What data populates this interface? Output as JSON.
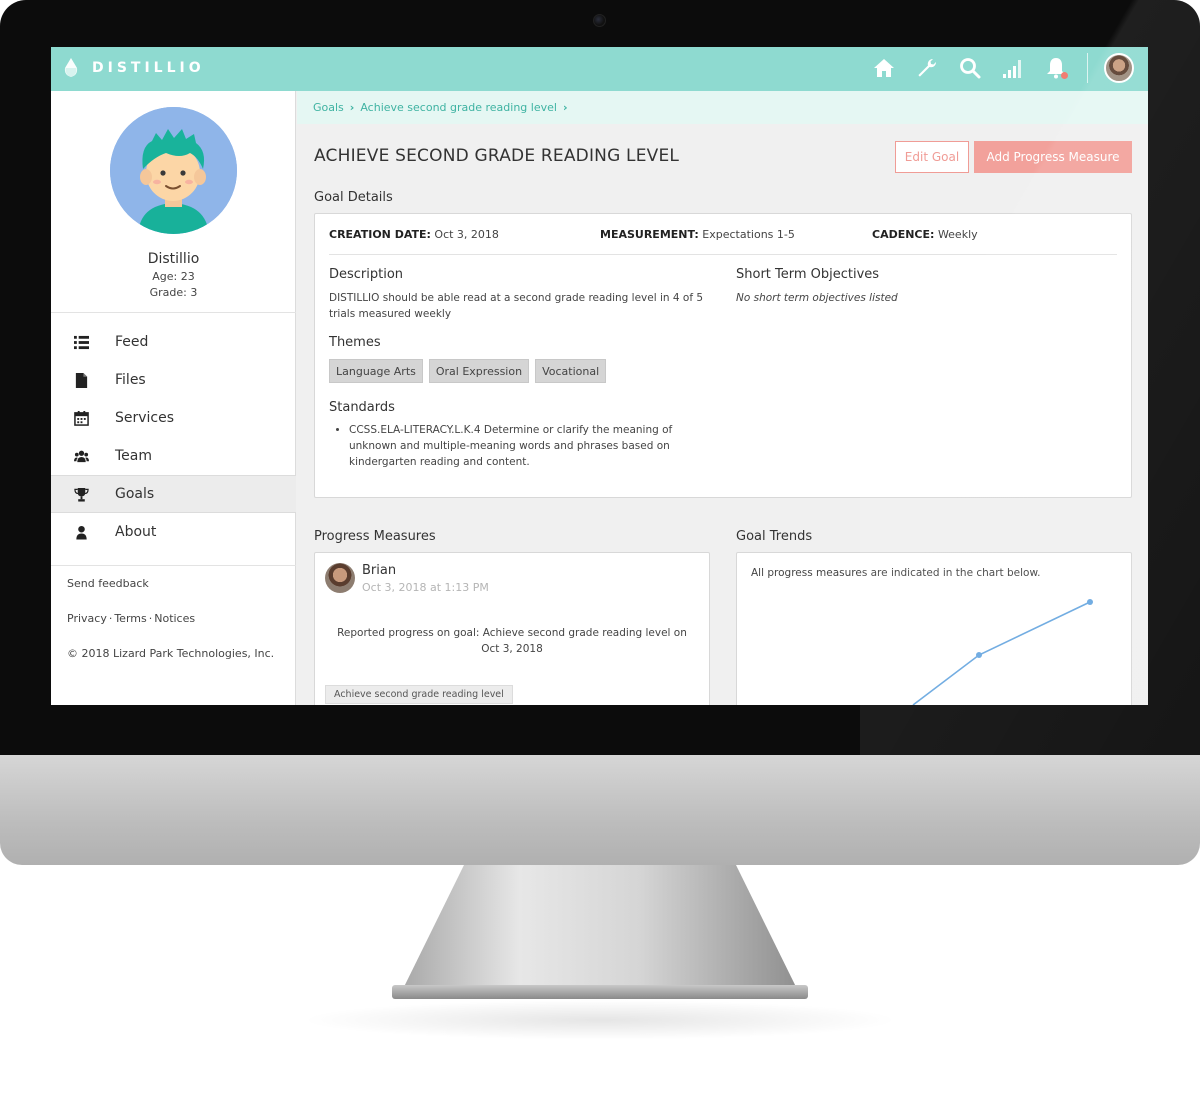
{
  "app": {
    "brand": "DISTILLIO"
  },
  "topbar": {
    "icons": [
      "home-icon",
      "wrench-icon",
      "search-icon",
      "signal-icon",
      "bell-icon",
      "user-avatar"
    ],
    "accent_color": "#8edad0",
    "notification_color": "#f17d72"
  },
  "profile": {
    "name": "Distillio",
    "age": "Age: 23",
    "grade": "Grade: 3"
  },
  "nav": {
    "items": [
      {
        "label": "Feed",
        "icon": "list-icon"
      },
      {
        "label": "Files",
        "icon": "file-icon"
      },
      {
        "label": "Services",
        "icon": "calendar-icon"
      },
      {
        "label": "Team",
        "icon": "users-icon"
      },
      {
        "label": "Goals",
        "icon": "trophy-icon",
        "active": true
      },
      {
        "label": "About",
        "icon": "user-icon"
      }
    ]
  },
  "footer": {
    "feedback": "Send feedback",
    "privacy": "Privacy",
    "terms": "Terms",
    "notices": "Notices",
    "copyright": "© 2018 Lizard Park Technologies, Inc."
  },
  "breadcrumb": {
    "items": [
      "Goals",
      "Achieve second grade reading level"
    ]
  },
  "goal": {
    "title": "ACHIEVE SECOND GRADE READING LEVEL",
    "edit_label": "Edit Goal",
    "add_label": "Add Progress Measure",
    "details_heading": "Goal Details",
    "creation_label": "CREATION DATE:",
    "creation_value": "Oct 3, 2018",
    "measurement_label": "MEASUREMENT:",
    "measurement_value": "Expectations 1-5",
    "cadence_label": "CADENCE:",
    "cadence_value": "Weekly",
    "description_heading": "Description",
    "description": "DISTILLIO should be able read at a second grade reading level in 4 of 5 trials measured weekly",
    "objectives_heading": "Short Term Objectives",
    "objectives_empty": "No short term objectives listed",
    "themes_heading": "Themes",
    "themes": [
      "Language Arts",
      "Oral Expression",
      "Vocational"
    ],
    "standards_heading": "Standards",
    "standards": [
      "CCSS.ELA-LITERACY.L.K.4 Determine or clarify the meaning of unknown and multiple-meaning words and phrases based on kindergarten reading and content."
    ]
  },
  "progress": {
    "heading": "Progress Measures",
    "author": "Brian",
    "time": "Oct 3, 2018 at 1:13 PM",
    "text": "Reported progress on goal: Achieve second grade reading level on Oct 3, 2018",
    "tag": "Achieve second grade reading level"
  },
  "trends": {
    "heading": "Goal Trends",
    "note": "All progress measures are indicated in the chart below.",
    "line_color": "#6aa8e0"
  }
}
